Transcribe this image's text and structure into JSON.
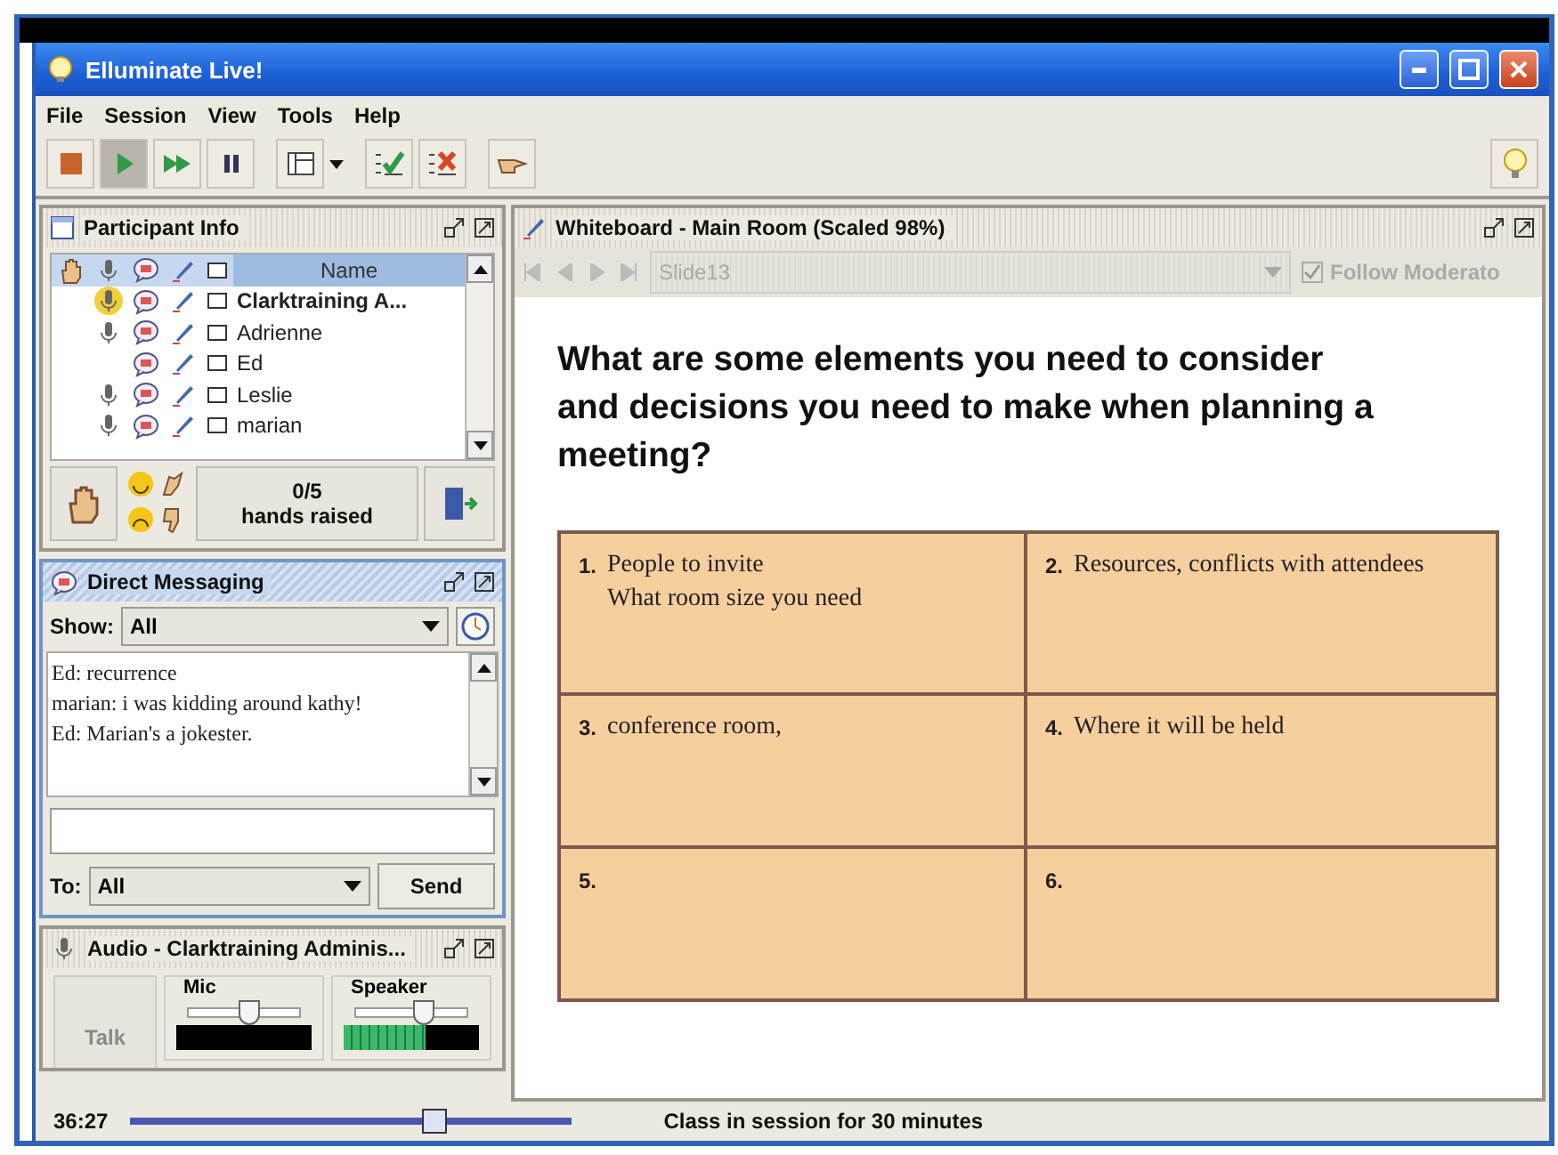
{
  "window": {
    "title": "Elluminate Live!"
  },
  "menu": [
    "File",
    "Session",
    "View",
    "Tools",
    "Help"
  ],
  "transport": [
    {
      "kind": "stop",
      "pressed": false
    },
    {
      "kind": "play",
      "pressed": true
    },
    {
      "kind": "forward",
      "pressed": false
    },
    {
      "kind": "pause",
      "pressed": false
    }
  ],
  "participant_info": {
    "title": "Participant Info",
    "name_column": "Name",
    "participants": [
      {
        "name": "Clarktraining A...",
        "current_user": true,
        "mic": true,
        "talking": true
      },
      {
        "name": "Adrienne",
        "current_user": false,
        "mic": true,
        "talking": false
      },
      {
        "name": "Ed",
        "current_user": false,
        "mic": false,
        "talking": false
      },
      {
        "name": "Leslie",
        "current_user": false,
        "mic": true,
        "talking": false
      },
      {
        "name": "marian",
        "current_user": false,
        "mic": true,
        "talking": false
      }
    ],
    "hands_count": "0/5",
    "hands_label": "hands raised"
  },
  "direct_messaging": {
    "title": "Direct Messaging",
    "show_label": "Show:",
    "show_value": "All",
    "messages": [
      "Ed: recurrence",
      "marian: i was kidding around kathy!",
      "Ed: Marian's a jokester."
    ],
    "to_label": "To:",
    "to_value": "All",
    "send": "Send"
  },
  "audio": {
    "title": "Audio - Clarktraining Adminis...",
    "talk": {
      "label": "Talk",
      "disabled": true
    },
    "mic": {
      "label": "Mic",
      "level": 0.55,
      "meter": {
        "level": 0
      }
    },
    "speaker": {
      "label": "Speaker",
      "level": 0.62,
      "meter": {
        "level": 0.6
      }
    }
  },
  "whiteboard": {
    "title": "Whiteboard - Main Room (Scaled 98%)",
    "slide": "Slide13",
    "follow": {
      "label": "Follow Moderato",
      "checked": true
    },
    "heading": "What are some elements you need to consider and decisions you need to make when planning a meeting?",
    "cells": [
      {
        "number": "1.",
        "lines": [
          "People to invite",
          "What room size you need"
        ]
      },
      {
        "number": "2.",
        "lines": [
          "Resources, conflicts with attendees"
        ]
      },
      {
        "number": "3.",
        "lines": [
          "conference room,"
        ]
      },
      {
        "number": "4.",
        "lines": [
          "Where it will be held"
        ]
      },
      {
        "number": "5."
      },
      {
        "number": "6."
      }
    ]
  },
  "status_bar": {
    "time": "36:27",
    "progress": {
      "level": 0.7
    },
    "message": "Class in session for 30 minutes"
  }
}
